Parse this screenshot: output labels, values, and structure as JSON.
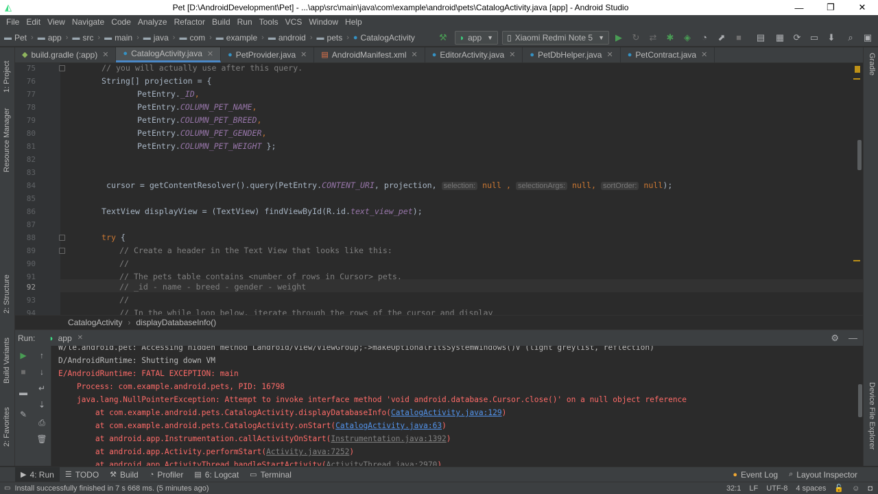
{
  "window": {
    "title": "Pet [D:\\AndroidDevelopment\\Pet] - ...\\app\\src\\main\\java\\com\\example\\android\\pets\\CatalogActivity.java [app] - Android Studio",
    "minimize": "—",
    "maximize": "❐",
    "close": "✕"
  },
  "menu": [
    "File",
    "Edit",
    "View",
    "Navigate",
    "Code",
    "Analyze",
    "Refactor",
    "Build",
    "Run",
    "Tools",
    "VCS",
    "Window",
    "Help"
  ],
  "navbar": {
    "crumbs": [
      "Pet",
      "app",
      "src",
      "main",
      "java",
      "com",
      "example",
      "android",
      "pets",
      "CatalogActivity"
    ],
    "run_config": "app",
    "device": "Xiaomi Redmi Note 5"
  },
  "tabs": [
    {
      "label": "build.gradle (:app)",
      "active": false
    },
    {
      "label": "CatalogActivity.java",
      "active": true
    },
    {
      "label": "PetProvider.java",
      "active": false
    },
    {
      "label": "AndroidManifest.xml",
      "active": false
    },
    {
      "label": "EditorActivity.java",
      "active": false
    },
    {
      "label": "PetDbHelper.java",
      "active": false
    },
    {
      "label": "PetContract.java",
      "active": false
    }
  ],
  "left_panel_labels": {
    "project": "1: Project",
    "resource_manager": "Resource Manager",
    "structure": "2: Structure",
    "build_variants": "Build Variants",
    "favorites": "2: Favorites"
  },
  "right_panel_labels": {
    "gradle": "Gradle",
    "device_file_explorer": "Device File Explorer"
  },
  "editor": {
    "line_numbers": [
      "75",
      "76",
      "77",
      "78",
      "79",
      "80",
      "81",
      "82",
      "83",
      "84",
      "85",
      "86",
      "87",
      "88",
      "89",
      "90",
      "91",
      "92",
      "93",
      "94"
    ],
    "lines": {
      "l75": "// you will actually use after this query.",
      "l76_type": "String[] projection = {",
      "l77_obj": "PetEntry.",
      "l77_fld": "_ID",
      "l77_end": ",",
      "l78_obj": "PetEntry.",
      "l78_fld": "COLUMN_PET_NAME",
      "l78_end": ",",
      "l79_obj": "PetEntry.",
      "l79_fld": "COLUMN_PET_BREED",
      "l79_end": ",",
      "l80_obj": "PetEntry.",
      "l80_fld": "COLUMN_PET_GENDER",
      "l80_end": ",",
      "l81_obj": "PetEntry.",
      "l81_fld": "COLUMN_PET_WEIGHT",
      "l81_end": " };",
      "l84_a": "cursor = getContentResolver().query(PetEntry.",
      "l84_fld": "CONTENT_URI",
      "l84_b": ", projection, ",
      "l84_h1": "selection:",
      "l84_v1": " null ",
      "l84_c1": ", ",
      "l84_h2": "selectionArgs:",
      "l84_v2": " null",
      "l84_c2": ", ",
      "l84_h3": "sortOrder:",
      "l84_v3": " null",
      "l84_end": ");",
      "l86_a": "TextView displayView = (TextView) findViewById(R.id.",
      "l86_fld": "text_view_pet",
      "l86_end": ");",
      "l88_kw": "try",
      "l88_end": " {",
      "l89": "// Create a header in the Text View that looks like this:",
      "l90": "//",
      "l91": "// The pets table contains <number of rows in Cursor> pets.",
      "l92": "// _id - name - breed - gender - weight",
      "l93": "//",
      "l94": "// In the while loop below, iterate through the rows of the cursor and display"
    }
  },
  "editor_breadcrumb": {
    "class": "CatalogActivity",
    "method": "displayDatabaseInfo()"
  },
  "run_panel": {
    "label": "Run:",
    "config": "app"
  },
  "console": {
    "c1": "W/le.android.pet: Accessing hidden method Landroid/view/ViewGroup;->makeOptionalFitsSystemWindows()V (light greylist, reflection)",
    "c2": "D/AndroidRuntime: Shutting down VM",
    "c3": "E/AndroidRuntime: FATAL EXCEPTION: main",
    "c4": "    Process: com.example.android.pets, PID: 16798",
    "c5": "    java.lang.NullPointerException: Attempt to invoke interface method 'void android.database.Cursor.close()' on a null object reference",
    "c6_a": "        at com.example.android.pets.CatalogActivity.displayDatabaseInfo(",
    "c6_link": "CatalogActivity.java:129",
    "c6_b": ")",
    "c7_a": "        at com.example.android.pets.CatalogActivity.onStart(",
    "c7_link": "CatalogActivity.java:63",
    "c7_b": ")",
    "c8_a": "        at android.app.Instrumentation.callActivityOnStart(",
    "c8_link": "Instrumentation.java:1392",
    "c8_b": ")",
    "c9_a": "        at android.app.Activity.performStart(",
    "c9_link": "Activity.java:7252",
    "c9_b": ")",
    "c10_a": "        at android.app.ActivityThread.handleStartActivity(",
    "c10_link": "ActivityThread.java:2970",
    "c10_b": ")"
  },
  "bottom_tabs": {
    "run": "4: Run",
    "todo": "TODO",
    "build": "Build",
    "profiler": "Profiler",
    "logcat": "6: Logcat",
    "terminal": "Terminal",
    "event_log": "Event Log",
    "layout_inspector": "Layout Inspector"
  },
  "status": {
    "message": "Install successfully finished in 7 s 668 ms. (5 minutes ago)",
    "position": "32:1",
    "line_sep": "LF",
    "encoding": "UTF-8",
    "indent": "4 spaces"
  },
  "colors": {
    "accent": "#4a88c7",
    "error": "#ff6b68",
    "run_green": "#499c54",
    "android_green": "#3ddc84"
  }
}
